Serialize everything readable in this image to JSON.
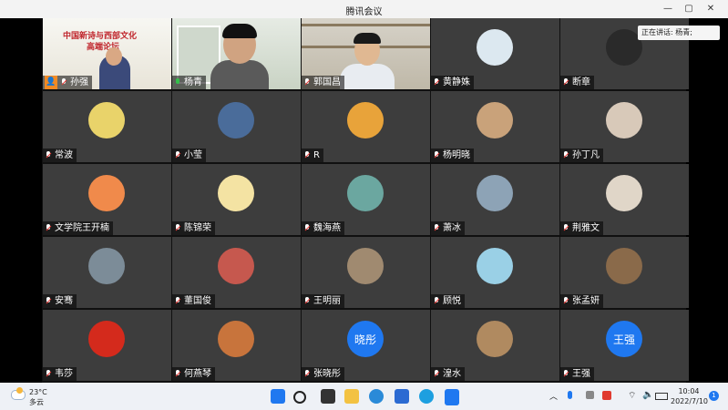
{
  "window": {
    "title": "腾讯会议"
  },
  "speaking": {
    "label": "正在讲话: 杨青;"
  },
  "participants": [
    {
      "name": "孙强",
      "type": "video",
      "host": true
    },
    {
      "name": "杨青",
      "type": "video",
      "mic": "on"
    },
    {
      "name": "郭国昌",
      "type": "video"
    },
    {
      "name": "黄静姝",
      "type": "avatar",
      "color": "#dce8f0"
    },
    {
      "name": "断章",
      "type": "avatar",
      "color": "#2a2a2a"
    },
    {
      "name": "常波",
      "type": "avatar",
      "color": "#e9d36a"
    },
    {
      "name": "小莹",
      "type": "avatar",
      "color": "#4a6c9a"
    },
    {
      "name": "R",
      "type": "avatar",
      "color": "#e8a33a"
    },
    {
      "name": "杨明晓",
      "type": "avatar",
      "color": "#c9a27a"
    },
    {
      "name": "孙丁凡",
      "type": "avatar",
      "color": "#d8c9b9"
    },
    {
      "name": "文学院王开楠",
      "type": "avatar",
      "color": "#f08a4b"
    },
    {
      "name": "陈锦荣",
      "type": "avatar",
      "color": "#f4e3a3"
    },
    {
      "name": "魏海燕",
      "type": "avatar",
      "color": "#6ba7a0"
    },
    {
      "name": "萧冰",
      "type": "avatar",
      "color": "#8da3b6"
    },
    {
      "name": "荆雅文",
      "type": "avatar",
      "color": "#e0d6c8"
    },
    {
      "name": "安骞",
      "type": "avatar",
      "color": "#7c8c98"
    },
    {
      "name": "董国俊",
      "type": "avatar",
      "color": "#c6584e"
    },
    {
      "name": "王明丽",
      "type": "avatar",
      "color": "#a08a70"
    },
    {
      "name": "顾悦",
      "type": "avatar",
      "color": "#9ad0e6"
    },
    {
      "name": "张孟妍",
      "type": "avatar",
      "color": "#8a6a4a"
    },
    {
      "name": "韦莎",
      "type": "avatar",
      "color": "#d42a1c"
    },
    {
      "name": "何燕琴",
      "type": "avatar",
      "color": "#c8743c"
    },
    {
      "name": "张晓彤",
      "type": "text",
      "initials": "晓彤",
      "color": "#1f78f0"
    },
    {
      "name": "湟水",
      "type": "avatar",
      "color": "#b08a60"
    },
    {
      "name": "王强",
      "type": "text",
      "initials": "王强",
      "color": "#1f78f0"
    }
  ],
  "slide": {
    "title_line1": "中国新诗与西部文化",
    "title_line2": "高端论坛"
  },
  "taskbar": {
    "weather_temp": "23°C",
    "weather_desc": "多云",
    "time": "10:04",
    "date": "2022/7/10",
    "notification_count": "1"
  },
  "colors": {
    "tile_bg": "#3d3d3d",
    "accent": "#1f78f0",
    "host_badge": "#f08a24"
  }
}
